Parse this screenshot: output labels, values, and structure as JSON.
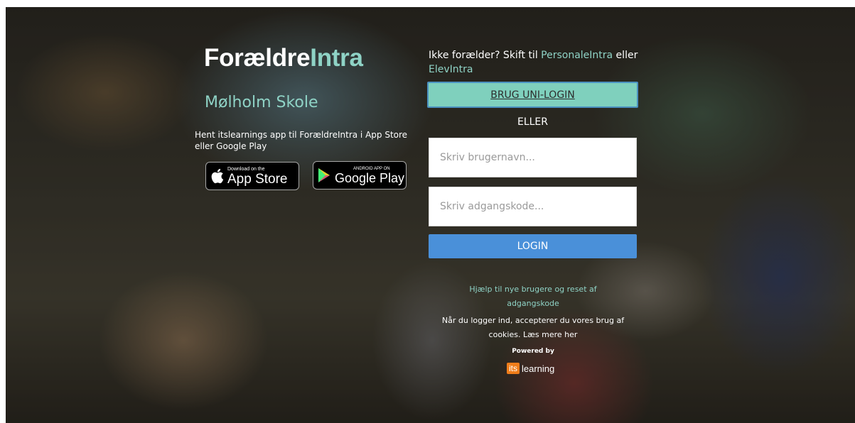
{
  "brand": {
    "part1": "Forældre",
    "part2": "Intra"
  },
  "school_name": "Mølholm Skole",
  "app_promo": {
    "text": "Hent itslearnings app til ForældreIntra i App Store eller Google Play",
    "appstore_small": "Download on the",
    "appstore_big": "App Store",
    "play_small": "ANDROID APP ON",
    "play_big": "Google Play"
  },
  "switch": {
    "prefix": "Ikke forælder? Skift til ",
    "personale": "PersonaleIntra",
    "middle": " eller ",
    "elev": "ElevIntra"
  },
  "uni_login_label": "BRUG UNI-LOGIN",
  "or_label": "ELLER",
  "username": {
    "placeholder": "Skriv brugernavn...",
    "value": ""
  },
  "password": {
    "placeholder": "Skriv adgangskode...",
    "value": ""
  },
  "login_label": "LOGIN",
  "help_link": "Hjælp til nye brugere og reset af adgangskode",
  "cookie": {
    "text": "Når du logger ind, accepterer du vores brug af cookies. ",
    "more": "Læs mere her"
  },
  "powered_by": "Powered by",
  "its_logo": {
    "box": "its",
    "word": "learning"
  },
  "colors": {
    "accent": "#8fd3c6",
    "uni_login_bg": "#7fd0bd",
    "login_bg": "#4a90d9",
    "its_orange": "#f07d1a"
  }
}
